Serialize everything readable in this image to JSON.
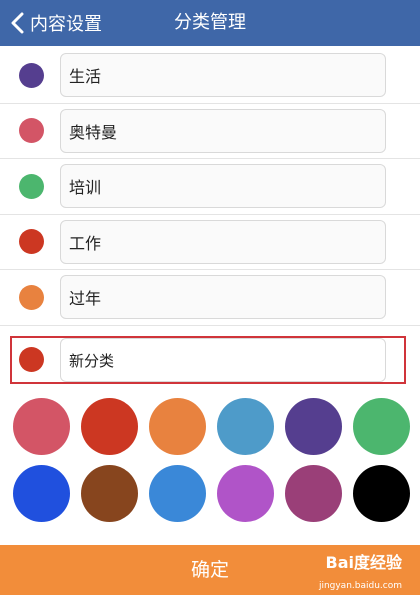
{
  "navbar": {
    "back_label": "内容设置",
    "title": "分类管理"
  },
  "categories": [
    {
      "name": "生活",
      "color": "#553e8f"
    },
    {
      "name": "奥特曼",
      "color": "#d35566"
    },
    {
      "name": "培训",
      "color": "#4cb66e"
    },
    {
      "name": "工作",
      "color": "#cc3722"
    },
    {
      "name": "过年",
      "color": "#e8823f"
    }
  ],
  "new_category": {
    "value": "新分类",
    "color": "#cc3722"
  },
  "palette": [
    "#d35566",
    "#cc3722",
    "#e8823f",
    "#4e9bc9",
    "#553e8f",
    "#4cb66e",
    "#2050de",
    "#87451e",
    "#3a88d8",
    "#b054c8",
    "#9a3f78",
    "#000000"
  ],
  "confirm_label": "确定",
  "watermark": {
    "brand": "Bai度经验",
    "url": "jingyan.baidu.com"
  }
}
